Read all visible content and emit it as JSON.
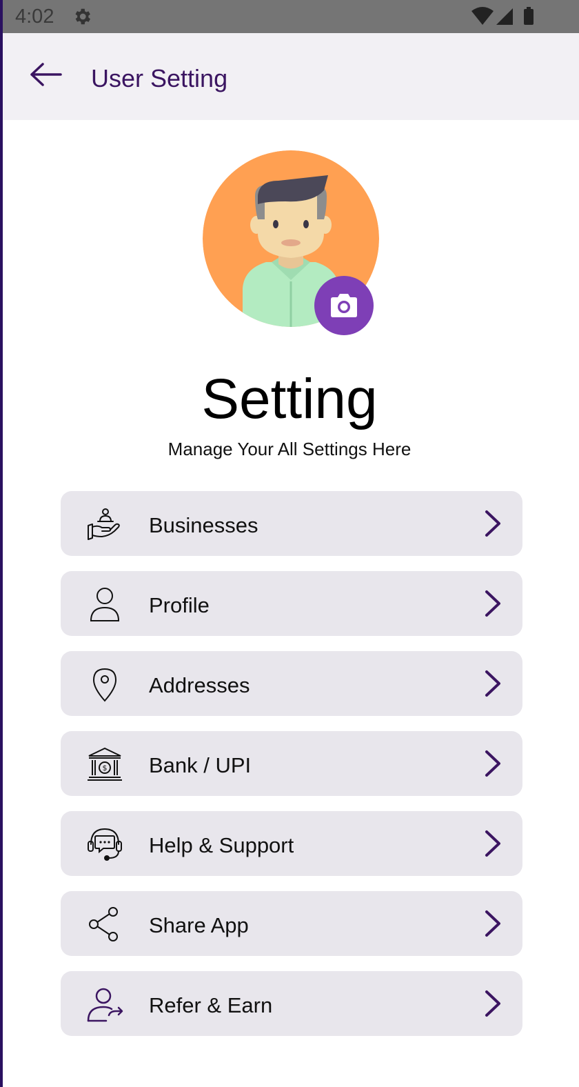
{
  "status_bar": {
    "time": "4:02",
    "icons": [
      "settings-gear-icon",
      "wifi-icon",
      "signal-icon",
      "battery-icon"
    ]
  },
  "app_bar": {
    "title": "User Setting",
    "back_icon": "arrow-left-icon"
  },
  "profile": {
    "avatar": "person-avatar-illustration",
    "camera_icon": "camera-icon",
    "avatar_bg_color": "#FFA052",
    "camera_bg_color": "#7E3FB6"
  },
  "header": {
    "title": "Setting",
    "subtitle": "Manage Your All Settings Here"
  },
  "menu": {
    "items": [
      {
        "label": "Businesses",
        "icon": "hand-user-icon"
      },
      {
        "label": "Profile",
        "icon": "user-icon"
      },
      {
        "label": "Addresses",
        "icon": "location-pin-icon"
      },
      {
        "label": "Bank / UPI",
        "icon": "bank-icon"
      },
      {
        "label": "Help & Support",
        "icon": "headset-chat-icon"
      },
      {
        "label": "Share App",
        "icon": "share-icon"
      },
      {
        "label": "Refer & Earn",
        "icon": "refer-user-icon"
      }
    ],
    "chevron_icon": "chevron-right-icon"
  },
  "colors": {
    "accent": "#3B1561",
    "item_bg": "#E8E6EC",
    "app_bar_bg": "#F2F0F4"
  }
}
